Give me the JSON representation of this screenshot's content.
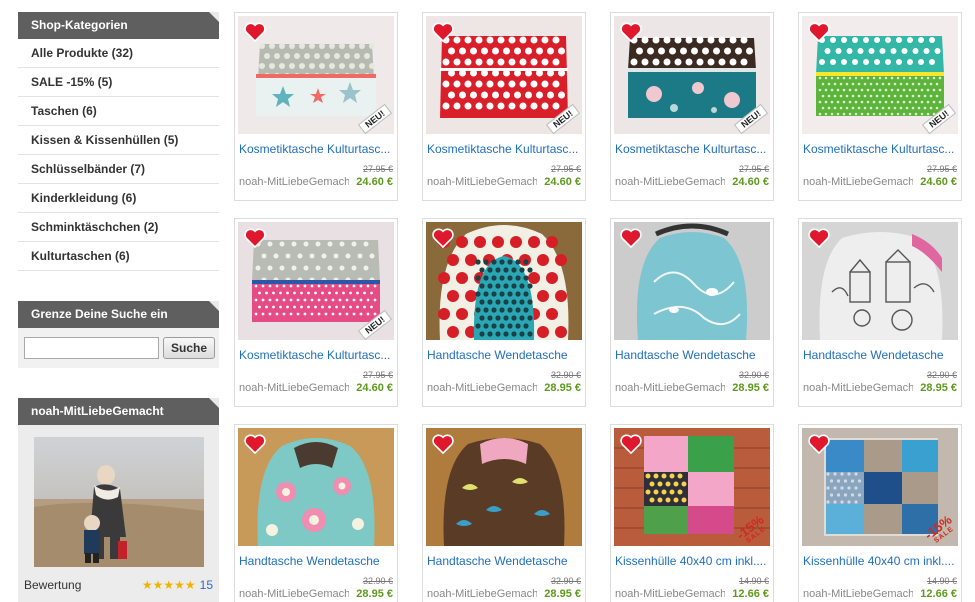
{
  "sidebar": {
    "categories_title": "Shop-Kategorien",
    "categories": [
      {
        "label": "Alle Produkte (32)"
      },
      {
        "label": "SALE -15% (5)"
      },
      {
        "label": "Taschen (6)"
      },
      {
        "label": "Kissen & Kissenhüllen (5)"
      },
      {
        "label": "Schlüsselbänder (7)"
      },
      {
        "label": "Kinderkleidung (6)"
      },
      {
        "label": "Schminktäschchen (2)"
      },
      {
        "label": "Kulturtaschen (6)"
      }
    ],
    "filter_title": "Grenze Deine Suche ein",
    "search_value": "",
    "search_button": "Suche",
    "shop_title": "noah-MitLiebeGemacht",
    "rating_label": "Bewertung",
    "rating_stars": 5,
    "rating_stars_text": "★★★★★",
    "rating_count": "15"
  },
  "products": [
    {
      "title": "Kosmetiktasche Kulturtasc...",
      "seller": "noah-MitLiebeGemacht",
      "old_price": "27.95 €",
      "price": "24.60 €",
      "badge": "NEU!"
    },
    {
      "title": "Kosmetiktasche Kulturtasc...",
      "seller": "noah-MitLiebeGemacht",
      "old_price": "27.95 €",
      "price": "24.60 €",
      "badge": "NEU!"
    },
    {
      "title": "Kosmetiktasche Kulturtasc...",
      "seller": "noah-MitLiebeGemacht",
      "old_price": "27.95 €",
      "price": "24.60 €",
      "badge": "NEU!"
    },
    {
      "title": "Kosmetiktasche Kulturtasc...",
      "seller": "noah-MitLiebeGemacht",
      "old_price": "27.95 €",
      "price": "24.60 €",
      "badge": "NEU!"
    },
    {
      "title": "Kosmetiktasche Kulturtasc...",
      "seller": "noah-MitLiebeGemacht",
      "old_price": "27.95 €",
      "price": "24.60 €",
      "badge": "NEU!"
    },
    {
      "title": "Handtasche Wendetasche",
      "seller": "noah-MitLiebeGemacht",
      "old_price": "32.90 €",
      "price": "28.95 €"
    },
    {
      "title": "Handtasche Wendetasche",
      "seller": "noah-MitLiebeGemacht",
      "old_price": "32.90 €",
      "price": "28.95 €"
    },
    {
      "title": "Handtasche Wendetasche",
      "seller": "noah-MitLiebeGemacht",
      "old_price": "32.90 €",
      "price": "28.95 €"
    },
    {
      "title": "Handtasche Wendetasche",
      "seller": "noah-MitLiebeGemacht",
      "old_price": "32.90 €",
      "price": "28.95 €"
    },
    {
      "title": "Handtasche Wendetasche",
      "seller": "noah-MitLiebeGemacht",
      "old_price": "32.90 €",
      "price": "28.95 €"
    },
    {
      "title": "Kissenhülle 40x40 cm inkl....",
      "seller": "noah-MitLiebeGemacht",
      "old_price": "14.90 €",
      "price": "12.66 €",
      "sale_pct": "-15%",
      "sale_text": "SALE"
    },
    {
      "title": "Kissenhülle 40x40 cm inkl....",
      "seller": "noah-MitLiebeGemacht",
      "old_price": "14.90 €",
      "price": "12.66 €",
      "sale_pct": "-15%",
      "sale_text": "SALE"
    }
  ],
  "colors": {
    "header_bg": "#5f5f5f",
    "link": "#1f6fbf",
    "price": "#5e9a1e",
    "heart": "#e0182d",
    "sale": "#d2281f",
    "star": "#f0b400"
  }
}
